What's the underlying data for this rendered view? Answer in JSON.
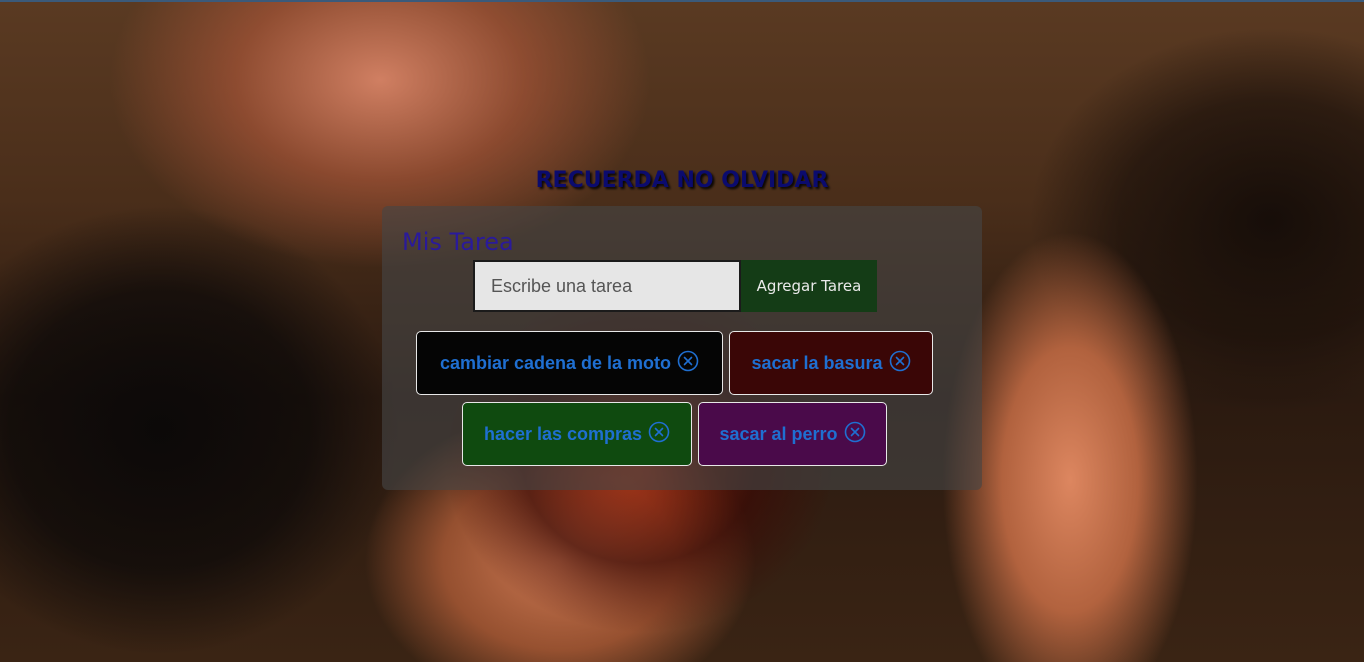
{
  "header": {
    "title": "RECUERDA NO OLVIDAR"
  },
  "panel": {
    "title": "Mis Tarea",
    "input_placeholder": "Escribe una tarea",
    "input_value": "",
    "add_button_label": "Agregar Tarea"
  },
  "tasks": [
    {
      "label": "cambiar cadena de la moto",
      "color": "#050505",
      "remove_icon": "x-circle-icon"
    },
    {
      "label": "sacar la basura",
      "color": "#3a0606",
      "remove_icon": "x-circle-icon"
    },
    {
      "label": "hacer las compras",
      "color": "#0f4a0f",
      "remove_icon": "x-circle-icon"
    },
    {
      "label": "sacar al perro",
      "color": "#4a0a4a",
      "remove_icon": "x-circle-icon"
    }
  ],
  "colors": {
    "title_text": "#0b0b6e",
    "panel_title_text": "#2a1a9a",
    "task_text": "#1f6fd1",
    "add_button_bg": "#143c16"
  }
}
